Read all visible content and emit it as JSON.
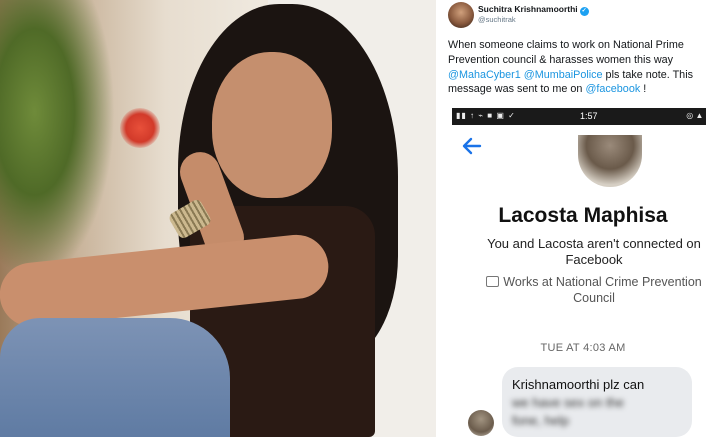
{
  "tweet": {
    "author_name": "Suchitra Krishnamoorthi",
    "verified_icon": "verified-badge-icon",
    "handle": "@suchitrak",
    "text_before_mentions": "When someone claims to work on National Prime Prevention council & harasses women this way ",
    "mention1": "@MahaCyber1",
    "mention2": "@MumbaiPolice",
    "text_after_mentions": " pls take note. This message was sent to me on ",
    "mention3": "@facebook",
    "text_end": " !"
  },
  "phone": {
    "status_time": "1:57",
    "status_left_icons": "▮▮ ↑ ⌁ ■ ▣ ✓",
    "status_right_icons": "◎ ▲ ▮",
    "back_icon": "back-arrow-icon",
    "profile_name": "Lacosta Maphisa",
    "connection_text": "You and Lacosta aren't connected on Facebook",
    "work_text": "Works at National Crime Prevention Council",
    "timestamp": "TUE AT 4:03 AM",
    "message_line1": "Krishnamoorthi plz can",
    "message_line2": "we have sex on the",
    "message_line3": "fone, help"
  },
  "colors": {
    "accent_blue": "#1b95e0",
    "messenger_blue": "#1a73e8",
    "bubble_gray": "#e9ebee",
    "status_bar": "#1a1a1a"
  }
}
